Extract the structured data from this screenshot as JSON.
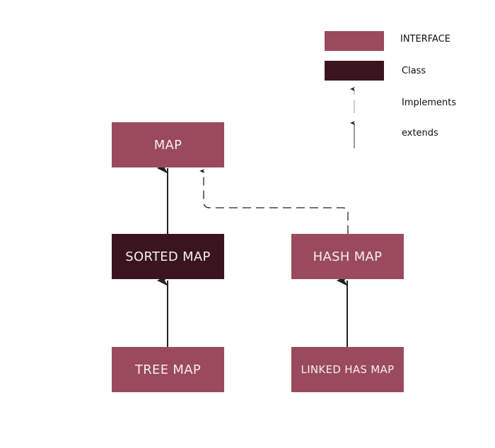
{
  "colors": {
    "interface": "#9a4a5c",
    "class": "#3a151e",
    "arrow": "#222222"
  },
  "legend": {
    "interface": "INTERFACE",
    "class": "Class",
    "implements": "Implements",
    "extends": "extends"
  },
  "nodes": {
    "map": "MAP",
    "sorted_map": "SORTED MAP",
    "hash_map": "HASH MAP",
    "tree_map": "TREE MAP",
    "linked_hash_map": "LINKED HAS MAP"
  }
}
